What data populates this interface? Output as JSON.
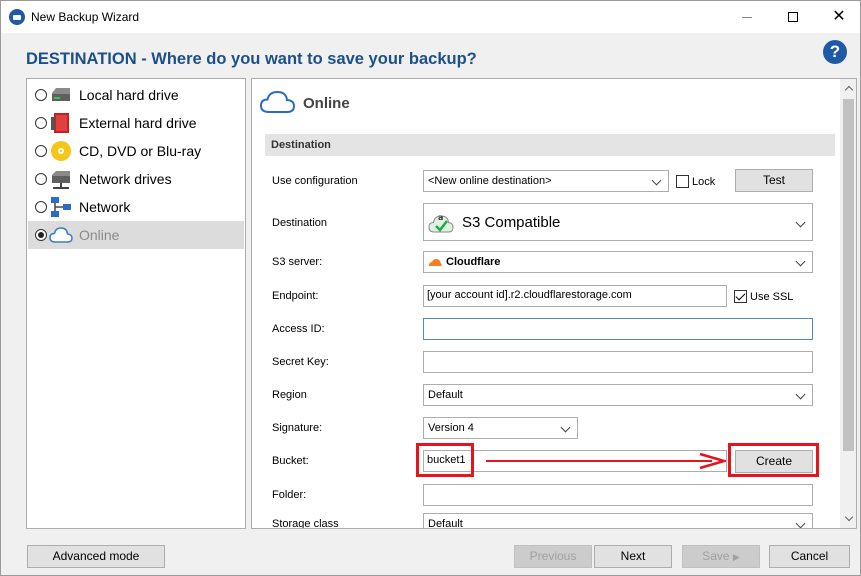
{
  "window": {
    "title": "New Backup Wizard"
  },
  "header": {
    "title": "DESTINATION - Where do you want to save your backup?",
    "help": "?"
  },
  "destinations": [
    {
      "label": "Local hard drive",
      "icon": "hard-drive-icon",
      "selected": false
    },
    {
      "label": "External hard drive",
      "icon": "external-drive-icon",
      "selected": false
    },
    {
      "label": "CD, DVD or Blu-ray",
      "icon": "disc-icon",
      "selected": false
    },
    {
      "label": "Network drives",
      "icon": "network-drive-icon",
      "selected": false
    },
    {
      "label": "Network",
      "icon": "network-icon",
      "selected": false
    },
    {
      "label": "Online",
      "icon": "cloud-icon",
      "selected": true
    }
  ],
  "panel": {
    "title": "Online",
    "section": "Destination",
    "use_configuration": {
      "label": "Use configuration",
      "value": "<New online destination>",
      "lock_label": "Lock",
      "lock_checked": false,
      "test_label": "Test"
    },
    "destination": {
      "label": "Destination",
      "value": "S3 Compatible"
    },
    "s3_server": {
      "label": "S3 server:",
      "value": "Cloudflare"
    },
    "endpoint": {
      "label": "Endpoint:",
      "value": "[your account id].r2.cloudflarestorage.com",
      "use_ssl_label": "Use SSL",
      "use_ssl_checked": true
    },
    "access_id": {
      "label": "Access ID:",
      "value": ""
    },
    "secret_key": {
      "label": "Secret Key:",
      "value": ""
    },
    "region": {
      "label": "Region",
      "value": "Default"
    },
    "signature": {
      "label": "Signature:",
      "value": "Version 4"
    },
    "bucket": {
      "label": "Bucket:",
      "value": "bucket1",
      "create_label": "Create"
    },
    "folder": {
      "label": "Folder:",
      "value": ""
    },
    "storage_class": {
      "label": "Storage class",
      "value": "Default"
    }
  },
  "colors": {
    "accent": "#1d4f8a",
    "annotation": "#e8131b"
  },
  "footer": {
    "advanced_label": "Advanced mode",
    "previous_label": "Previous",
    "next_label": "Next",
    "save_label": "Save",
    "cancel_label": "Cancel"
  }
}
